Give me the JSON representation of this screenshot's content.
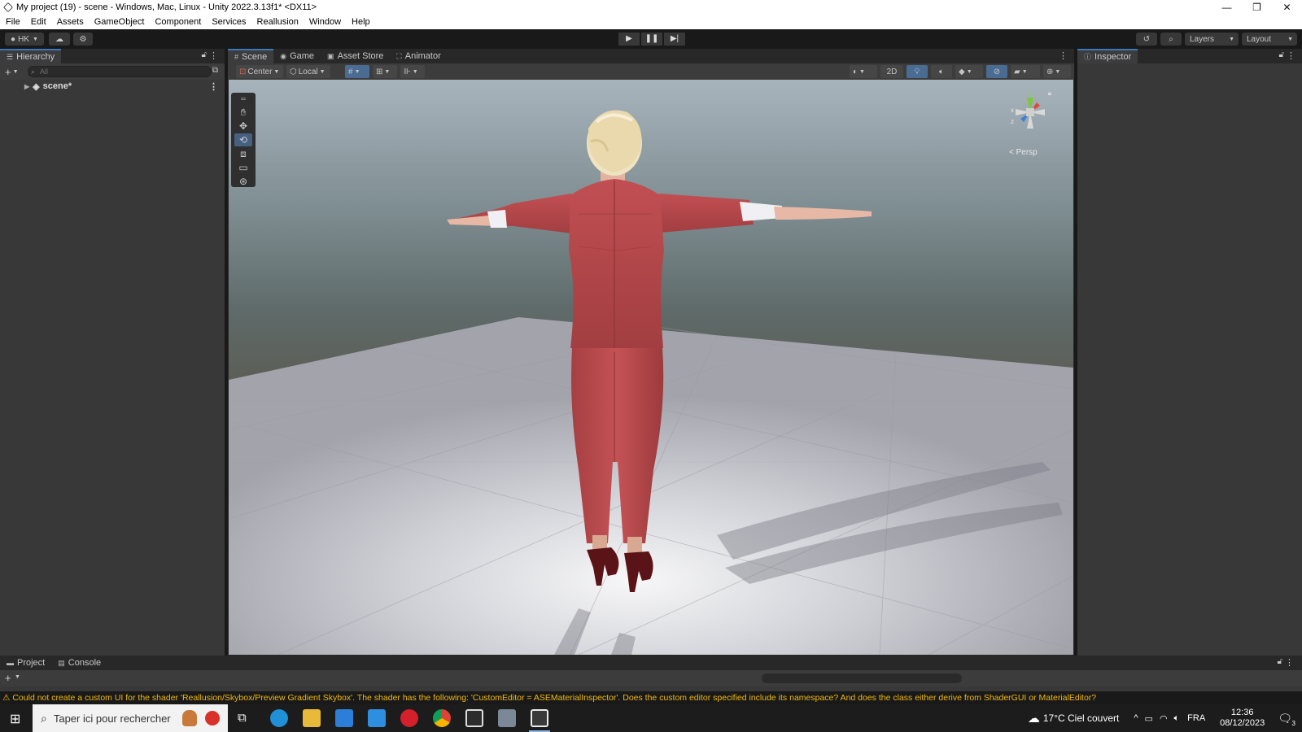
{
  "window": {
    "title": "My project (19) - scene - Windows, Mac, Linux - Unity 2022.3.13f1* <DX11>",
    "controls": [
      "—",
      "❐",
      "✕"
    ]
  },
  "menu": [
    "File",
    "Edit",
    "Assets",
    "GameObject",
    "Component",
    "Services",
    "Reallusion",
    "Window",
    "Help"
  ],
  "toolbar": {
    "account": "HK",
    "layers_label": "Layers",
    "layout_label": "Layout"
  },
  "hierarchy": {
    "tab": "Hierarchy",
    "search_placeholder": "All",
    "root_item": "scene*"
  },
  "scene_tabs": [
    {
      "label": "Scene",
      "icon": "#",
      "active": true
    },
    {
      "label": "Game",
      "icon": "◉"
    },
    {
      "label": "Asset Store",
      "icon": "▣"
    },
    {
      "label": "Animator",
      "icon": "⛶"
    }
  ],
  "scene_toolbar": {
    "pivot": "Center",
    "space": "Local",
    "mode_2d": "2D"
  },
  "gizmo": {
    "y": "y",
    "x": "x",
    "z": "z",
    "projection": "< Persp"
  },
  "inspector": {
    "tab": "Inspector"
  },
  "bottom": {
    "tabs": [
      "Project",
      "Console"
    ]
  },
  "status": {
    "message": "Could not create a custom UI for the shader 'Reallusion/Skybox/Preview Gradient Skybox'. The shader has the following: 'CustomEditor = ASEMaterialInspector'. Does the custom editor specified include its namespace? And does the class either derive from ShaderGUI or MaterialEditor?"
  },
  "taskbar": {
    "search_placeholder": "Taper ici pour rechercher",
    "weather": "17°C  Ciel couvert",
    "language": "FRA",
    "time": "12:36",
    "date": "08/12/2023",
    "notifications": "3"
  },
  "colors": {
    "accent": "#3a79bb",
    "warning": "#f0b80e",
    "jacket": "#b8484a"
  }
}
